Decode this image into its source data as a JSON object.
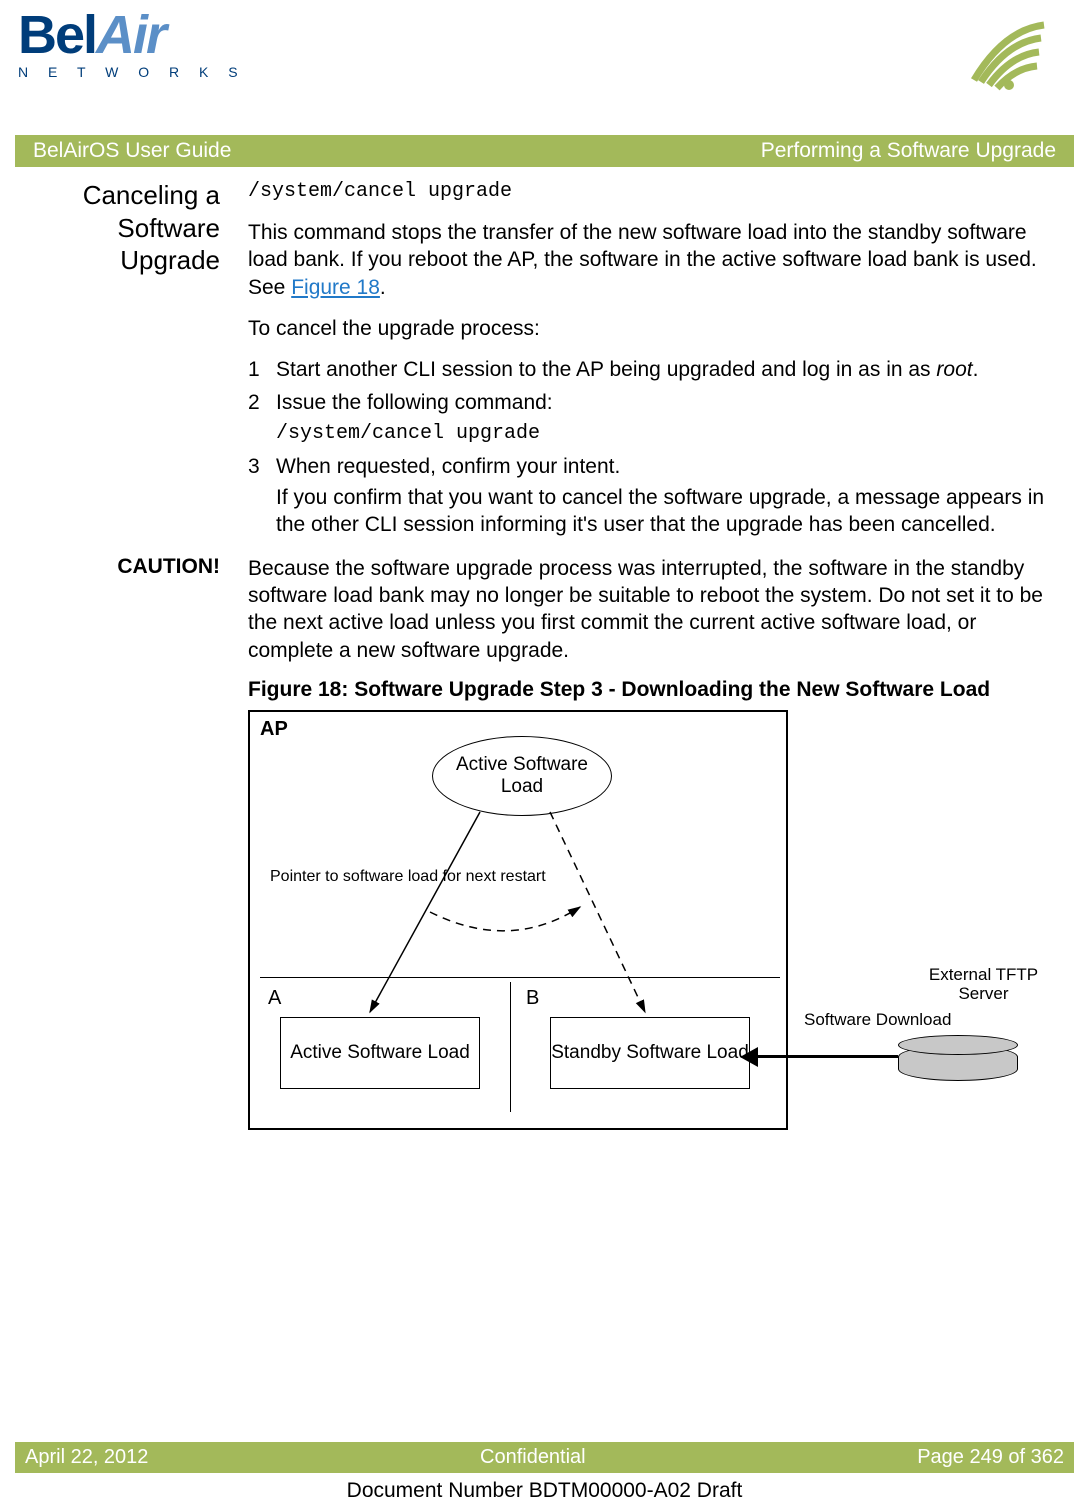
{
  "logo": {
    "main_prefix": "Bel",
    "main_suffix": "Air",
    "subtext": "N E T W O R K S"
  },
  "title_bar": {
    "left": "BelAirOS User Guide",
    "right": "Performing a Software Upgrade"
  },
  "section": {
    "heading": "Canceling a Software Upgrade",
    "command": "/system/cancel upgrade",
    "intro_text_part1": "This command stops the transfer of the new software load into the standby software load bank. If you reboot the AP, the software in the active software load bank is used. See ",
    "intro_link": "Figure 18",
    "intro_text_part2": ".",
    "process_intro": "To cancel the upgrade process:",
    "steps": [
      {
        "num": "1",
        "text_prefix": "Start another CLI session to the AP being upgraded and log in as in as ",
        "text_italic": "root",
        "text_suffix": "."
      },
      {
        "num": "2",
        "text": "Issue the following command:",
        "code": "/system/cancel upgrade"
      },
      {
        "num": "3",
        "text": "When requested, confirm your intent.",
        "sub": "If you confirm that you want to cancel the software upgrade, a message appears in the other CLI session informing it's user that the upgrade has been cancelled."
      }
    ]
  },
  "caution": {
    "label": "CAUTION!",
    "text": "Because the software upgrade process was interrupted, the software in the standby software load bank may no longer be suitable to reboot the system. Do not set it to be the next active load unless you first commit the current active software load, or complete a new software upgrade."
  },
  "figure": {
    "caption": "Figure 18: Software Upgrade Step 3 - Downloading the New Software Load",
    "ap_label": "AP",
    "oval_text": "Active Software Load",
    "pointer_text": "Pointer to software load for next restart",
    "letter_a": "A",
    "letter_b": "B",
    "box_a_text": "Active Software Load",
    "box_b_text": "Standby Software Load",
    "download_label": "Software Download",
    "server_label": "External TFTP Server"
  },
  "footer": {
    "date": "April 22, 2012",
    "confidentiality": "Confidential",
    "page": "Page 249 of 362",
    "doc_number": "Document Number BDTM00000-A02 Draft"
  }
}
